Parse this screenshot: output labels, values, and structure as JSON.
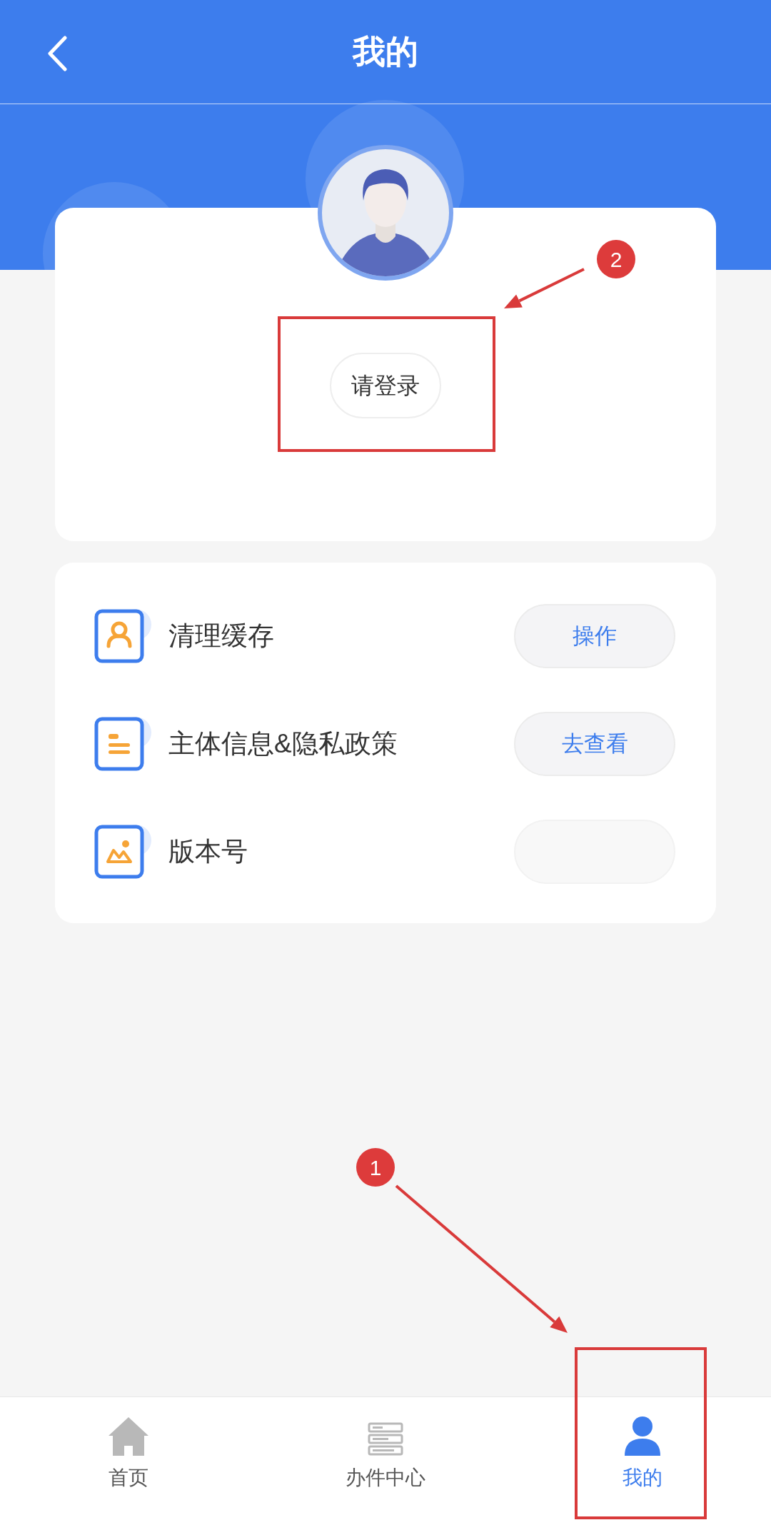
{
  "header": {
    "title": "我的"
  },
  "profile": {
    "login_button": "请登录"
  },
  "settings": [
    {
      "label": "清理缓存",
      "kind": "person",
      "action": "操作"
    },
    {
      "label": "主体信息&隐私政策",
      "kind": "document",
      "action": "去查看"
    },
    {
      "label": "版本号",
      "kind": "image"
    }
  ],
  "tab_bar": [
    {
      "label": "首页",
      "kind": "home",
      "selected": false
    },
    {
      "label": "办件中心",
      "kind": "list",
      "selected": false
    },
    {
      "label": "我的",
      "kind": "person",
      "selected": true
    }
  ],
  "annotations": [
    {
      "number": "2"
    },
    {
      "number": "1"
    }
  ]
}
